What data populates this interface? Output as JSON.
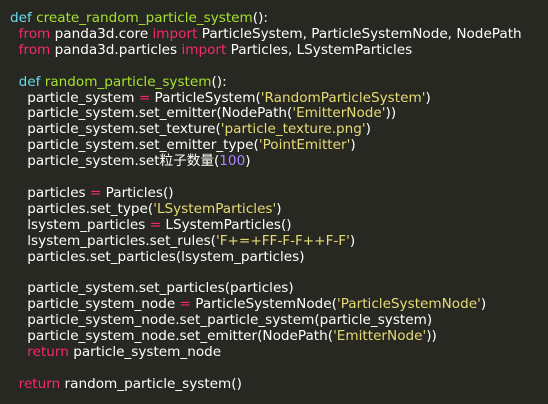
{
  "editor": {
    "background": "#272822",
    "colors": {
      "keyword": "#66d9ef",
      "import": "#f92672",
      "function": "#a6e22e",
      "string": "#e6db74",
      "number": "#ae81ff",
      "operator": "#f92672",
      "text": "#ffffff"
    },
    "lines": [
      [
        {
          "t": "def",
          "c": "kw"
        },
        {
          "t": " ",
          "c": "txt"
        },
        {
          "t": "create_random_particle_system",
          "c": "fn"
        },
        {
          "t": "():",
          "c": "txt"
        }
      ],
      [
        {
          "t": "  ",
          "c": "txt"
        },
        {
          "t": "from",
          "c": "imp"
        },
        {
          "t": " panda3d.core ",
          "c": "txt"
        },
        {
          "t": "import",
          "c": "imp"
        },
        {
          "t": " ParticleSystem, ParticleSystemNode, NodePath",
          "c": "txt"
        }
      ],
      [
        {
          "t": "  ",
          "c": "txt"
        },
        {
          "t": "from",
          "c": "imp"
        },
        {
          "t": " panda3d.particles ",
          "c": "txt"
        },
        {
          "t": "import",
          "c": "imp"
        },
        {
          "t": " Particles, LSystemParticles",
          "c": "txt"
        }
      ],
      [],
      [
        {
          "t": "  ",
          "c": "txt"
        },
        {
          "t": "def",
          "c": "kw"
        },
        {
          "t": " ",
          "c": "txt"
        },
        {
          "t": "random_particle_system",
          "c": "fn"
        },
        {
          "t": "():",
          "c": "txt"
        }
      ],
      [
        {
          "t": "    particle_system ",
          "c": "txt"
        },
        {
          "t": "=",
          "c": "op"
        },
        {
          "t": " ParticleSystem(",
          "c": "txt"
        },
        {
          "t": "'RandomParticleSystem'",
          "c": "str"
        },
        {
          "t": ")",
          "c": "txt"
        }
      ],
      [
        {
          "t": "    particle_system.set_emitter(NodePath(",
          "c": "txt"
        },
        {
          "t": "'EmitterNode'",
          "c": "str"
        },
        {
          "t": "))",
          "c": "txt"
        }
      ],
      [
        {
          "t": "    particle_system.set_texture(",
          "c": "txt"
        },
        {
          "t": "'particle_texture.png'",
          "c": "str"
        },
        {
          "t": ")",
          "c": "txt"
        }
      ],
      [
        {
          "t": "    particle_system.set_emitter_type(",
          "c": "txt"
        },
        {
          "t": "'PointEmitter'",
          "c": "str"
        },
        {
          "t": ")",
          "c": "txt"
        }
      ],
      [
        {
          "t": "    particle_system.set粒子数量(",
          "c": "txt"
        },
        {
          "t": "100",
          "c": "num"
        },
        {
          "t": ")",
          "c": "txt"
        }
      ],
      [],
      [
        {
          "t": "    particles ",
          "c": "txt"
        },
        {
          "t": "=",
          "c": "op"
        },
        {
          "t": " Particles()",
          "c": "txt"
        }
      ],
      [
        {
          "t": "    particles.set_type(",
          "c": "txt"
        },
        {
          "t": "'LSystemParticles'",
          "c": "str"
        },
        {
          "t": ")",
          "c": "txt"
        }
      ],
      [
        {
          "t": "    lsystem_particles ",
          "c": "txt"
        },
        {
          "t": "=",
          "c": "op"
        },
        {
          "t": " LSystemParticles()",
          "c": "txt"
        }
      ],
      [
        {
          "t": "    lsystem_particles.set_rules(",
          "c": "txt"
        },
        {
          "t": "'F+=+FF-F-F++F-F'",
          "c": "str"
        },
        {
          "t": ")",
          "c": "txt"
        }
      ],
      [
        {
          "t": "    particles.set_particles(lsystem_particles)",
          "c": "txt"
        }
      ],
      [],
      [
        {
          "t": "    particle_system.set_particles(particles)",
          "c": "txt"
        }
      ],
      [
        {
          "t": "    particle_system_node ",
          "c": "txt"
        },
        {
          "t": "=",
          "c": "op"
        },
        {
          "t": " ParticleSystemNode(",
          "c": "txt"
        },
        {
          "t": "'ParticleSystemNode'",
          "c": "str"
        },
        {
          "t": ")",
          "c": "txt"
        }
      ],
      [
        {
          "t": "    particle_system_node.set_particle_system(particle_system)",
          "c": "txt"
        }
      ],
      [
        {
          "t": "    particle_system_node.set_emitter(NodePath(",
          "c": "txt"
        },
        {
          "t": "'EmitterNode'",
          "c": "str"
        },
        {
          "t": "))",
          "c": "txt"
        }
      ],
      [
        {
          "t": "    ",
          "c": "txt"
        },
        {
          "t": "return",
          "c": "imp"
        },
        {
          "t": " particle_system_node",
          "c": "txt"
        }
      ],
      [],
      [
        {
          "t": "  ",
          "c": "txt"
        },
        {
          "t": "return",
          "c": "imp"
        },
        {
          "t": " random_particle_system()",
          "c": "txt"
        }
      ]
    ]
  }
}
